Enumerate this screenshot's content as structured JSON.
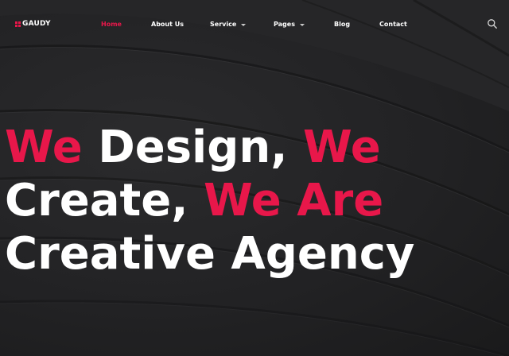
{
  "brand": {
    "name": "GAUDY",
    "accent_color": "#e8174a",
    "text_color": "#ffffff",
    "background_color": "#1f1f20"
  },
  "nav": {
    "items": [
      {
        "label": "Home",
        "active": true,
        "has_dropdown": false
      },
      {
        "label": "About Us",
        "active": false,
        "has_dropdown": false
      },
      {
        "label": "Service",
        "active": false,
        "has_dropdown": true
      },
      {
        "label": "Pages",
        "active": false,
        "has_dropdown": true
      },
      {
        "label": "Blog",
        "active": false,
        "has_dropdown": false
      },
      {
        "label": "Contact",
        "active": false,
        "has_dropdown": false
      }
    ],
    "search_icon": "search-icon",
    "dropdown_icon": "chevron-down-icon"
  },
  "hero": {
    "line1": {
      "accent_a": "We",
      "plain": " Design, ",
      "accent_b": "We"
    },
    "line2": {
      "plain": "Create, ",
      "accent": "We Are"
    },
    "line3": {
      "plain": "Creative Agency"
    }
  }
}
